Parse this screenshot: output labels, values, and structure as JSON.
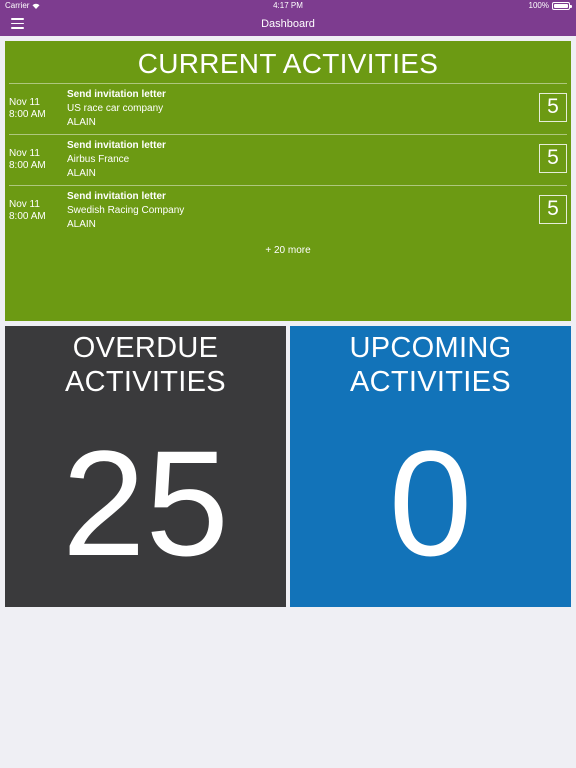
{
  "status_bar": {
    "carrier": "Carrier",
    "time": "4:17 PM",
    "battery": "100%",
    "battery_level": 1.0
  },
  "navbar": {
    "title": "Dashboard",
    "menu_icon": "hamburger-menu-icon"
  },
  "current_activities": {
    "title": "CURRENT ACTIVITIES",
    "items": [
      {
        "date": "Nov 11",
        "time": "8:00 AM",
        "title": "Send invitation letter",
        "company": "US race car company",
        "user": "ALAIN",
        "priority": "5"
      },
      {
        "date": "Nov 11",
        "time": "8:00 AM",
        "title": "Send invitation letter",
        "company": "Airbus France",
        "user": "ALAIN",
        "priority": "5"
      },
      {
        "date": "Nov 11",
        "time": "8:00 AM",
        "title": "Send invitation letter",
        "company": "Swedish Racing Company",
        "user": "ALAIN",
        "priority": "5"
      }
    ],
    "more": "+ 20 more"
  },
  "overdue": {
    "title_line1": "OVERDUE",
    "title_line2": "ACTIVITIES",
    "count": "25"
  },
  "upcoming": {
    "title_line1": "UPCOMING",
    "title_line2": "ACTIVITIES",
    "count": "0"
  },
  "colors": {
    "topbar": "#7d3c8f",
    "current_bg": "#6c9a13",
    "overdue_bg": "#3a3a3c",
    "upcoming_bg": "#1273b9",
    "page_bg": "#efeff4"
  }
}
